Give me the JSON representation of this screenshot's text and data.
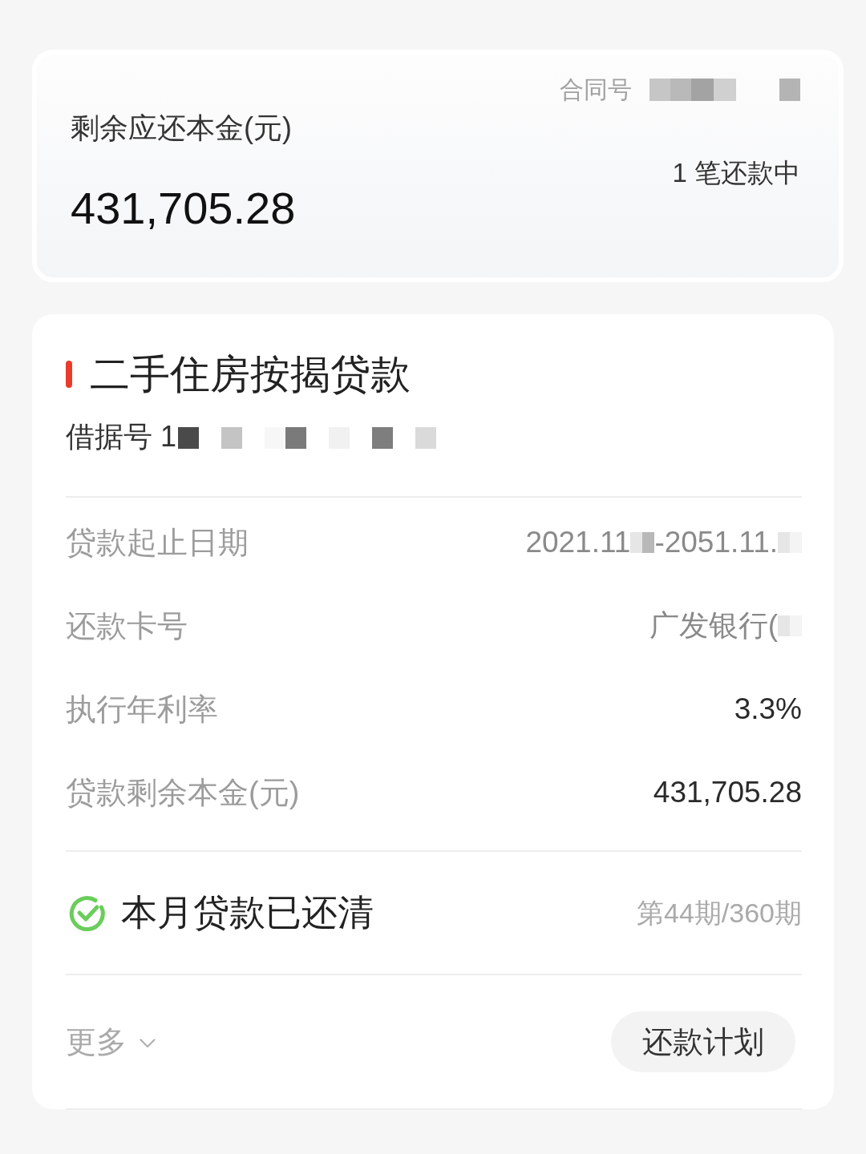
{
  "summary": {
    "title": "剩余应还本金(元)",
    "amount": "431,705.28",
    "contract_label": "合同号",
    "contract_redacted": true,
    "status": "1 笔还款中"
  },
  "loan": {
    "title": "二手住房按揭贷款",
    "receipt_label": "借据号 1",
    "receipt_redacted": true,
    "details": [
      {
        "label": "贷款起止日期",
        "highlighted": false,
        "value": [
          {
            "kind": "text",
            "text": "2021.11"
          },
          {
            "kind": "redacted"
          },
          {
            "kind": "text",
            "text": "-2051.11."
          },
          {
            "kind": "redacted"
          }
        ]
      },
      {
        "label": "还款卡号",
        "highlighted": false,
        "value": [
          {
            "kind": "text",
            "text": "广发银行("
          },
          {
            "kind": "redacted"
          }
        ]
      },
      {
        "label": "执行年利率",
        "highlighted": true,
        "value": [
          {
            "kind": "text",
            "text": "3.3%"
          }
        ]
      },
      {
        "label": "贷款剩余本金(元)",
        "highlighted": true,
        "value": [
          {
            "kind": "text",
            "text": "431,705.28"
          }
        ]
      }
    ],
    "status": {
      "message": "本月贷款已还清",
      "period": "第44期/360期"
    },
    "more": "更多",
    "plan_button": "还款计划"
  }
}
